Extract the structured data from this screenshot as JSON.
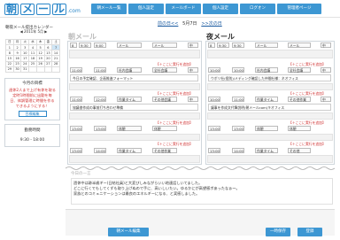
{
  "logo": {
    "part1": "朝",
    "part2": "メ",
    "part3": "ー",
    "part4": "ル",
    "suffix": ".com"
  },
  "nav": [
    "朝メール一覧",
    "個人設定",
    "メールボード",
    "個人設定",
    "ログオン",
    "管理者ページ"
  ],
  "date_nav": {
    "prev": "前の日<<",
    "date": "5月7日",
    "next": ">>次の日"
  },
  "calendar": {
    "title": "朝夜メール提出カレンダー",
    "month": "2011年 5月",
    "weekdays": [
      "日",
      "月",
      "火",
      "水",
      "木",
      "金",
      "土"
    ],
    "rows": [
      [
        "1",
        "2",
        "3",
        "4",
        "5",
        "6",
        "7"
      ],
      [
        "8",
        "9",
        "10",
        "11",
        "12",
        "13",
        "14"
      ],
      [
        "15",
        "16",
        "17",
        "18",
        "19",
        "20",
        "21"
      ],
      [
        "22",
        "23",
        "24",
        "25",
        "26",
        "27",
        "28"
      ],
      [
        "29",
        "30",
        "31",
        "",
        "",
        "",
        ""
      ]
    ]
  },
  "today_goal": {
    "title": "今月の目標",
    "lines": [
      "週休2人まで上げ有休を取る",
      "定時1時間前に出勤を毎",
      "日、体調管理に時間を作る",
      "できるようにする！"
    ],
    "button": "目標編集"
  },
  "work_time": {
    "title": "勤務時間",
    "value": "9:30 - 18:00"
  },
  "morning": {
    "title": "朝メール",
    "row1": [
      "8",
      "9:30",
      "9:00",
      "メール",
      "メール",
      "中"
    ],
    "link": "【＋ここに実行を追加】",
    "items": [
      {
        "start": "11:00",
        "end": "11:00",
        "cat": "社内会議",
        "cat2": "全社会議",
        "desc": "今日の予定確認、企画推進フォーマット"
      },
      {
        "start": "11:00",
        "end": "12:00",
        "cat": "作業タイム",
        "cat2": "その他会議",
        "desc": "協議書作成の事前打ち合わせ準備"
      },
      {
        "start": "13:00",
        "end": "13:00",
        "cat": "休憩",
        "cat2": "休憩",
        "desc": ""
      },
      {
        "start": "13:00",
        "end": "14:00",
        "cat": "作業タイム",
        "cat2": "その他作業",
        "desc": ""
      }
    ],
    "row_times": [
      "10:00",
      "11:00",
      "12:00"
    ]
  },
  "night": {
    "title": "夜メール",
    "row1": [
      "8",
      "9:30",
      "9:30",
      "メール",
      "メール",
      "中"
    ],
    "link": "【＋ここに実行を追加】",
    "items": [
      {
        "start": "10:00",
        "end": "10:00",
        "cat": "社内会議",
        "cat2": "全社会議",
        "desc": "ウボリ社(個別)/メディング確認した仲間社様：ネオフィス"
      },
      {
        "start": "10:00",
        "end": "11:00",
        "cat": "作業タイム",
        "cat2": "その他作業",
        "desc": "議事を作成文代筆説明(朝メールcom)キオフィス"
      },
      {
        "start": "13:00",
        "end": "13:00",
        "cat": "休憩",
        "cat2": "休憩",
        "desc": ""
      },
      {
        "start": "13:00",
        "end": "14:00",
        "cat": "作業タイム",
        "cat2": "その他",
        "desc": ""
      }
    ]
  },
  "today_comment": {
    "label": "今日の一言",
    "lines": [
      "過休中は跡半歳ギー(日結社員)と大変びしみながらいい地連話しいてました。",
      "どこに行くでもしてくずも取り上げぬので手に、高いしいたい。ゆるかにが高望感ボあったなぁ～。",
      "家族とのコミュニケーションは最良のエネルギーになる、と実感しました。"
    ]
  },
  "buttons": {
    "edit_morning": "朝メール編集",
    "temp_save": "一時保存",
    "submit": "登録"
  }
}
